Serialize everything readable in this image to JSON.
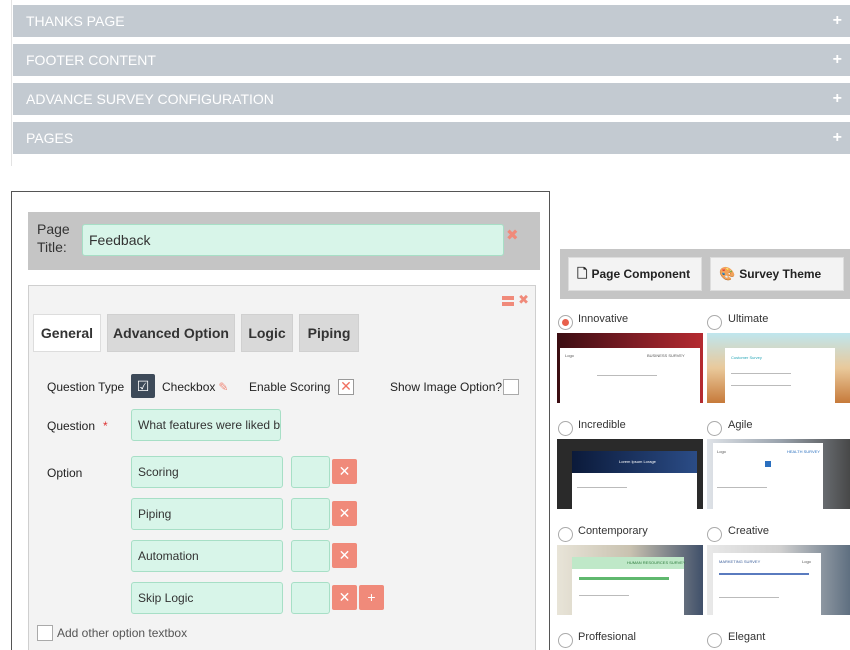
{
  "accordion": [
    {
      "label": "THANKS PAGE"
    },
    {
      "label": "FOOTER CONTENT"
    },
    {
      "label": "ADVANCE SURVEY CONFIGURATION"
    },
    {
      "label": "PAGES"
    }
  ],
  "accordion_expand_symbol": "+",
  "page_title": {
    "label": "Page Title:",
    "value": "Feedback"
  },
  "tabs": [
    {
      "label": "General"
    },
    {
      "label": "Advanced Option"
    },
    {
      "label": "Logic"
    },
    {
      "label": "Piping"
    }
  ],
  "question_type": {
    "label": "Question Type",
    "value": "Checkbox"
  },
  "enable_scoring": {
    "label": "Enable Scoring"
  },
  "show_image_option": {
    "label": "Show Image Option?"
  },
  "question": {
    "label": "Question",
    "required_mark": "*",
    "value": "What features were liked by"
  },
  "option": {
    "label": "Option",
    "items": [
      "Scoring",
      "Piping",
      "Automation",
      "Skip Logic"
    ]
  },
  "add_other_option": {
    "label": "Add other option textbox"
  },
  "right_panel": {
    "page_component_label": "Page Component",
    "survey_theme_label": "Survey Theme"
  },
  "themes": [
    {
      "name": "Innovative",
      "selected": true
    },
    {
      "name": "Ultimate",
      "selected": false
    },
    {
      "name": "Incredible",
      "selected": false
    },
    {
      "name": "Agile",
      "selected": false
    },
    {
      "name": "Contemporary",
      "selected": false
    },
    {
      "name": "Creative",
      "selected": false
    },
    {
      "name": "Proffesional",
      "selected": false
    },
    {
      "name": "Elegant",
      "selected": false
    }
  ],
  "theme_thumbs": {
    "innovative_header": "BUSINESS SURVEY",
    "ultimate_header": "Customer Survey",
    "incredible_header": "Lorem Ipsum Lorage",
    "agile_header": "HEALTH SURVEY",
    "contemporary_header": "HUMAN RESOURCES SURVEY",
    "creative_header": "MARKETING SURVEY",
    "logo_text": "Logo"
  },
  "colors": {
    "accordion": "#c3cad1",
    "field_bg": "#d8f5e9",
    "danger": "#f08a7a",
    "grey_bar": "#c5c5c5"
  }
}
